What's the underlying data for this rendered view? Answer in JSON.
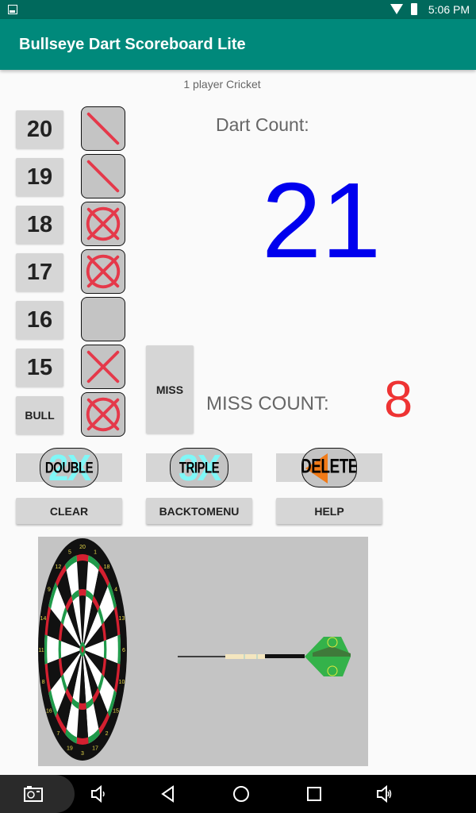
{
  "status_bar": {
    "time": "5:06 PM",
    "icons": [
      "image-icon",
      "wifi-icon",
      "battery-icon"
    ]
  },
  "app_bar": {
    "title": "Bullseye Dart Scoreboard Lite"
  },
  "game_mode": "1 player Cricket",
  "targets": [
    {
      "label": "20",
      "marks": 1
    },
    {
      "label": "19",
      "marks": 1
    },
    {
      "label": "18",
      "marks": 3
    },
    {
      "label": "17",
      "marks": 3
    },
    {
      "label": "16",
      "marks": 0
    },
    {
      "label": "15",
      "marks": 2
    },
    {
      "label": "BULL",
      "marks": 3
    }
  ],
  "miss_button": "MISS",
  "dart_count": {
    "label": "Dart Count:",
    "value": "21"
  },
  "miss_count": {
    "label": "MISS COUNT:",
    "value": "8"
  },
  "modifiers": {
    "double": {
      "label": "DOUBLE",
      "badge": "2X"
    },
    "triple": {
      "label": "TRIPLE",
      "badge": "3X"
    },
    "delete": {
      "label": "DELETE"
    }
  },
  "actions": {
    "clear": "CLEAR",
    "back": "BACKTOMENU",
    "help": "HELP"
  },
  "dartboard_numbers": [
    "20",
    "1",
    "18",
    "4",
    "13",
    "6",
    "10",
    "15",
    "2",
    "17",
    "3",
    "19",
    "7",
    "16",
    "8",
    "11",
    "14",
    "9",
    "12",
    "5"
  ],
  "colors": {
    "accent": "#00897b",
    "dark_accent": "#00695c",
    "dart_count": "#0000ee",
    "miss_count": "#ee3333",
    "mark": "#e5394a"
  },
  "nav_bar": {
    "icons": [
      "screenshot-icon",
      "volume-down-icon",
      "back-icon",
      "home-icon",
      "recents-icon",
      "volume-up-icon"
    ]
  }
}
